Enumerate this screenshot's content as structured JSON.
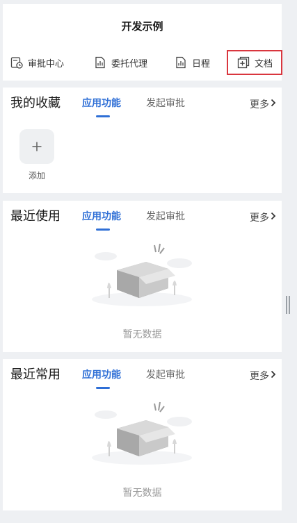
{
  "page": {
    "title": "开发示例"
  },
  "quick_actions": [
    {
      "label": "审批中心",
      "icon": "approval-clock-icon"
    },
    {
      "label": "委托代理",
      "icon": "delegate-chart-icon"
    },
    {
      "label": "日程",
      "icon": "schedule-chart-icon"
    },
    {
      "label": "文档",
      "icon": "document-add-icon",
      "selected": true
    }
  ],
  "favorites": {
    "title": "我的收藏",
    "tabs": [
      "应用功能",
      "发起审批"
    ],
    "active_tab": "应用功能",
    "more": "更多",
    "add_label": "添加"
  },
  "recent_used": {
    "title": "最近使用",
    "tabs": [
      "应用功能",
      "发起审批"
    ],
    "active_tab": "应用功能",
    "more": "更多",
    "empty_text": "暂无数据"
  },
  "recent_common": {
    "title": "最近常用",
    "tabs": [
      "应用功能",
      "发起审批"
    ],
    "active_tab": "应用功能",
    "more": "更多",
    "empty_text": "暂无数据"
  },
  "colors": {
    "accent": "#2f6fd6",
    "highlight": "#d9363e",
    "background": "#eef0f3"
  }
}
